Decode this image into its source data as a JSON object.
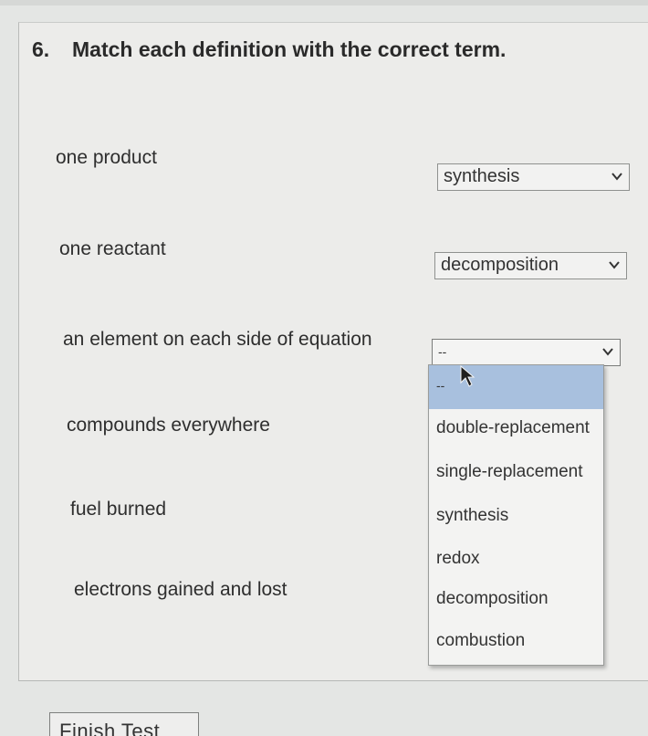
{
  "question": {
    "number": "6.",
    "prompt": "Match each definition with the correct term."
  },
  "definitions": [
    {
      "text": "one product",
      "selected": "synthesis"
    },
    {
      "text": "one reactant",
      "selected": "decomposition"
    },
    {
      "text": "an element on each side of equation",
      "selected": "--"
    },
    {
      "text": "compounds everywhere"
    },
    {
      "text": "fuel burned"
    },
    {
      "text": "electrons gained and lost"
    }
  ],
  "dropdown": {
    "options": [
      "--",
      "double-replacement",
      "single-replacement",
      "synthesis",
      "redox",
      "decomposition",
      "combustion"
    ],
    "highlighted_index": 0
  },
  "finish_button": "Finish Test",
  "colors": {
    "highlight": "#a8c0de",
    "background": "#e4e6e4"
  },
  "icons": [
    "chevron-down-icon",
    "mouse-pointer-icon"
  ]
}
